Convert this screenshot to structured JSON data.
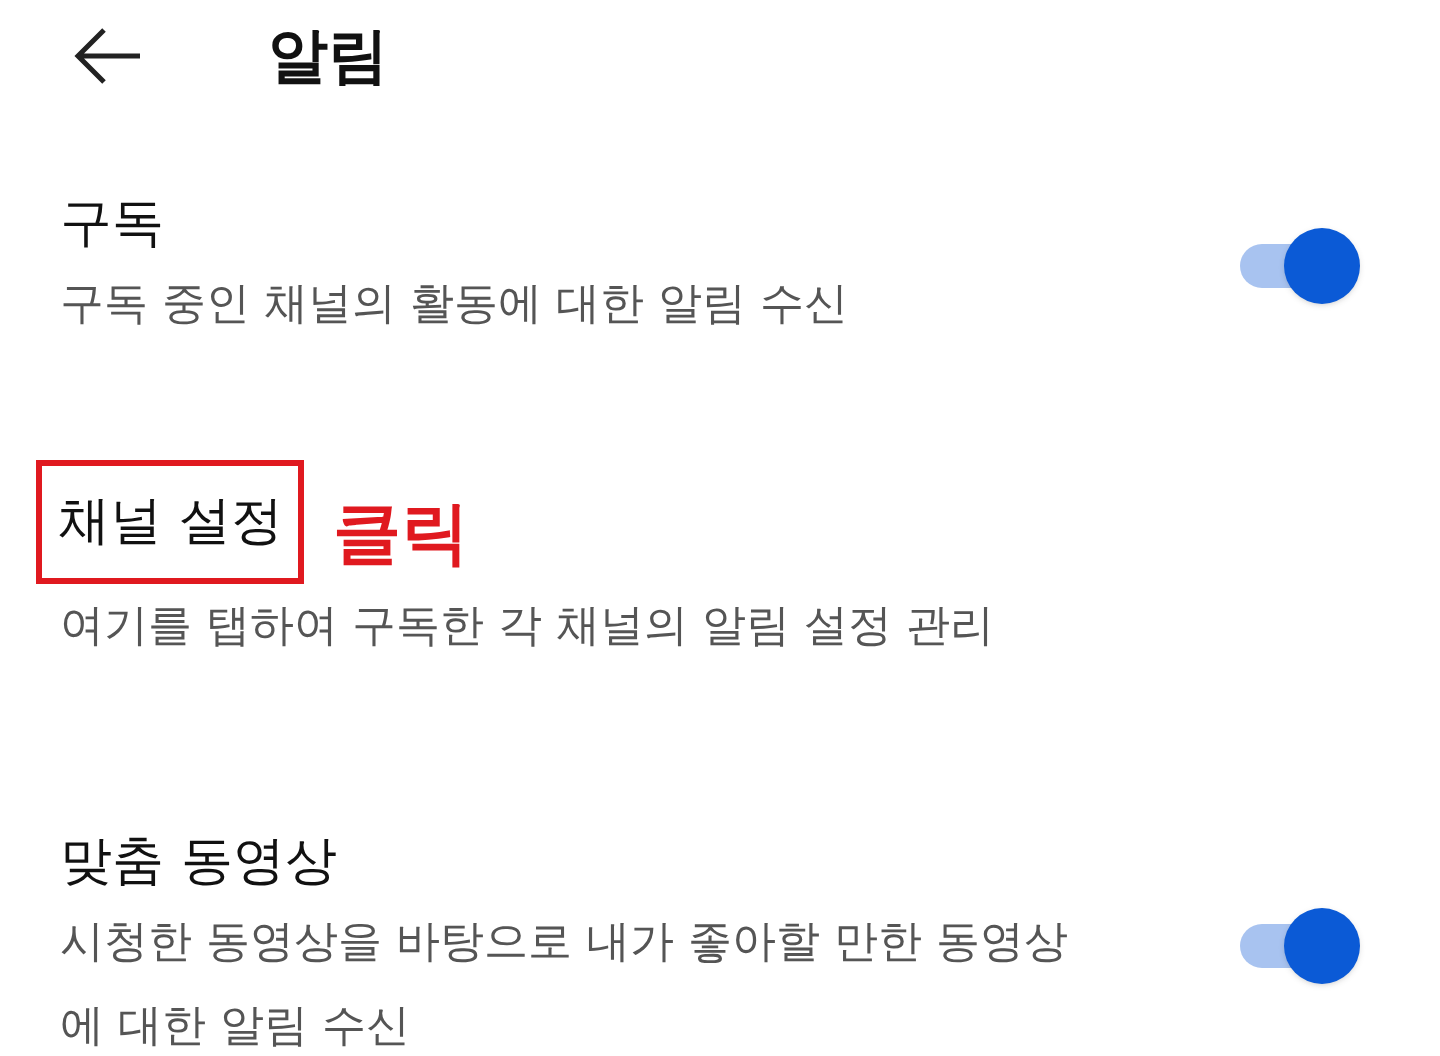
{
  "header": {
    "title": "알림"
  },
  "settings": [
    {
      "kind": "toggle",
      "title": "구독",
      "description": "구독 중인 채널의 활동에 대한 알림 수신",
      "on": true,
      "highlighted": false
    },
    {
      "kind": "link",
      "title": "채널 설정",
      "description": "여기를 탭하여 구독한 각 채널의 알림 설정 관리",
      "highlighted": true,
      "annotation": "클릭"
    },
    {
      "kind": "toggle",
      "title": "맞춤 동영상",
      "description": "시청한 동영상을 바탕으로 내가 좋아할 만한 동영상에 대한 알림 수신",
      "on": true,
      "highlighted": false
    }
  ]
}
